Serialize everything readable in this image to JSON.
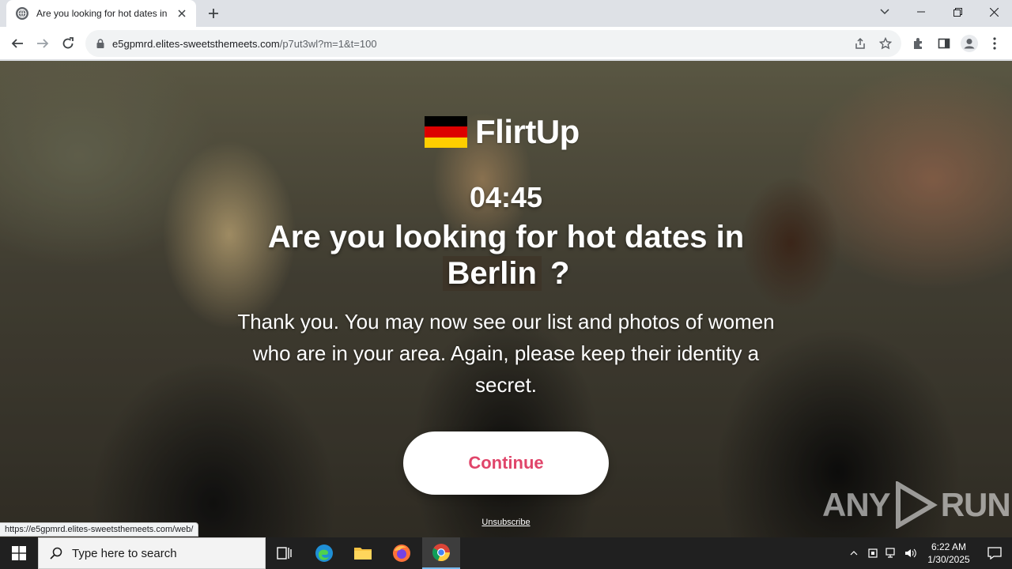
{
  "browser": {
    "tab_title": "Are you looking for hot dates in",
    "url_host": "e5gpmrd.elites-sweetsthemeets.com",
    "url_path": "/p7ut3wl?m=1&t=100",
    "status_url": "https://e5gpmrd.elites-sweetsthemeets.com/web/"
  },
  "page": {
    "brand": "FlirtUp",
    "flag_colors": [
      "#000000",
      "#dd0000",
      "#ffce00"
    ],
    "timer": "04:45",
    "headline_prefix": "Are you looking for hot dates in",
    "city": "Berlin",
    "headline_suffix": "?",
    "message": "Thank you. You may now see our list and photos of women who are in your area. Again, please keep their identity a secret.",
    "continue_label": "Continue",
    "unsubscribe_label": "Unsubscribe",
    "accent_color": "#e0456a",
    "watermark_left": "ANY",
    "watermark_right": "RUN"
  },
  "taskbar": {
    "search_placeholder": "Type here to search",
    "time": "6:22 AM",
    "date": "1/30/2025"
  }
}
